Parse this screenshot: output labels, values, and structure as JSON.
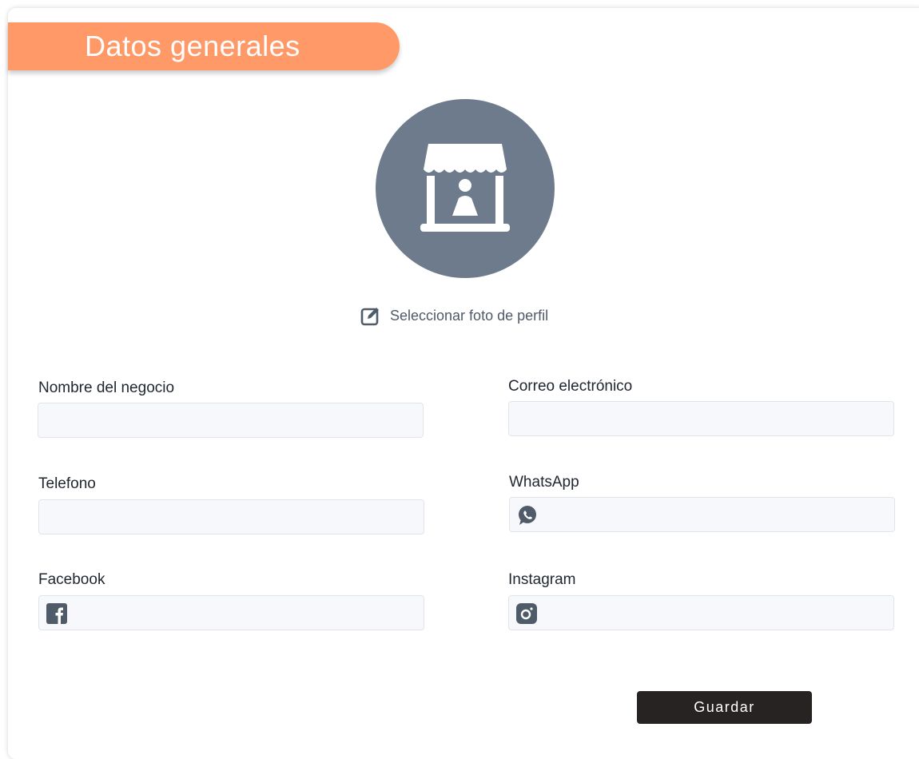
{
  "header": {
    "title": "Datos generales"
  },
  "profile": {
    "select_photo_label": "Seleccionar foto de perfil",
    "avatar_icon": "store-stall-icon",
    "edit_icon": "edit-icon"
  },
  "form": {
    "business_name": {
      "label": "Nombre del negocio",
      "value": "",
      "placeholder": ""
    },
    "email": {
      "label": "Correo electrónico",
      "value": "",
      "placeholder": ""
    },
    "phone": {
      "label": "Telefono",
      "value": "",
      "placeholder": ""
    },
    "whatsapp": {
      "label": "WhatsApp",
      "value": "",
      "placeholder": "",
      "icon": "whatsapp-icon"
    },
    "facebook": {
      "label": "Facebook",
      "value": "",
      "placeholder": "",
      "icon": "facebook-icon"
    },
    "instagram": {
      "label": "Instagram",
      "value": "",
      "placeholder": "",
      "icon": "instagram-icon"
    }
  },
  "actions": {
    "save_label": "Guardar"
  },
  "colors": {
    "accent": "#ff9a68",
    "avatar_bg": "#6e7b8c",
    "button_bg": "#262322",
    "input_bg": "#f6f8fb"
  }
}
